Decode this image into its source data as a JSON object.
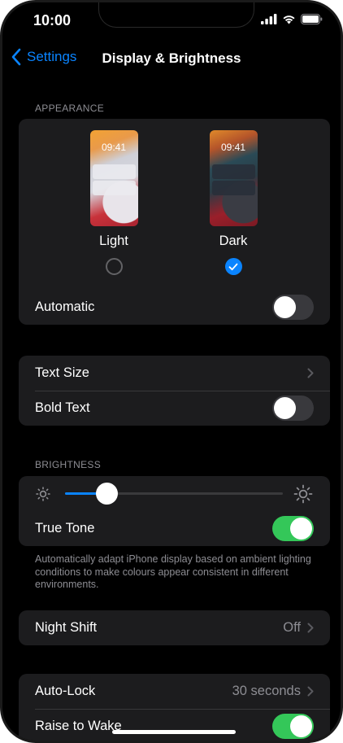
{
  "status": {
    "time": "10:00"
  },
  "nav": {
    "back_label": "Settings",
    "title": "Display & Brightness"
  },
  "appearance": {
    "header": "APPEARANCE",
    "light": {
      "label": "Light",
      "time": "09:41",
      "selected": false
    },
    "dark": {
      "label": "Dark",
      "time": "09:41",
      "selected": true
    },
    "automatic_label": "Automatic",
    "automatic_on": false
  },
  "text": {
    "text_size_label": "Text Size",
    "bold_text_label": "Bold Text",
    "bold_text_on": false
  },
  "brightness": {
    "header": "BRIGHTNESS",
    "level": 0.19,
    "true_tone_label": "True Tone",
    "true_tone_on": true,
    "footer": "Automatically adapt iPhone display based on ambient lighting conditions to make colours appear consistent in different environments."
  },
  "night_shift": {
    "label": "Night Shift",
    "value": "Off"
  },
  "lock": {
    "auto_lock_label": "Auto-Lock",
    "auto_lock_value": "30 seconds",
    "raise_to_wake_label": "Raise to Wake",
    "raise_to_wake_on": true
  },
  "colors": {
    "accent": "#0a84ff",
    "toggle_on": "#34c759",
    "background": "#000000",
    "cell": "#1c1c1e"
  }
}
